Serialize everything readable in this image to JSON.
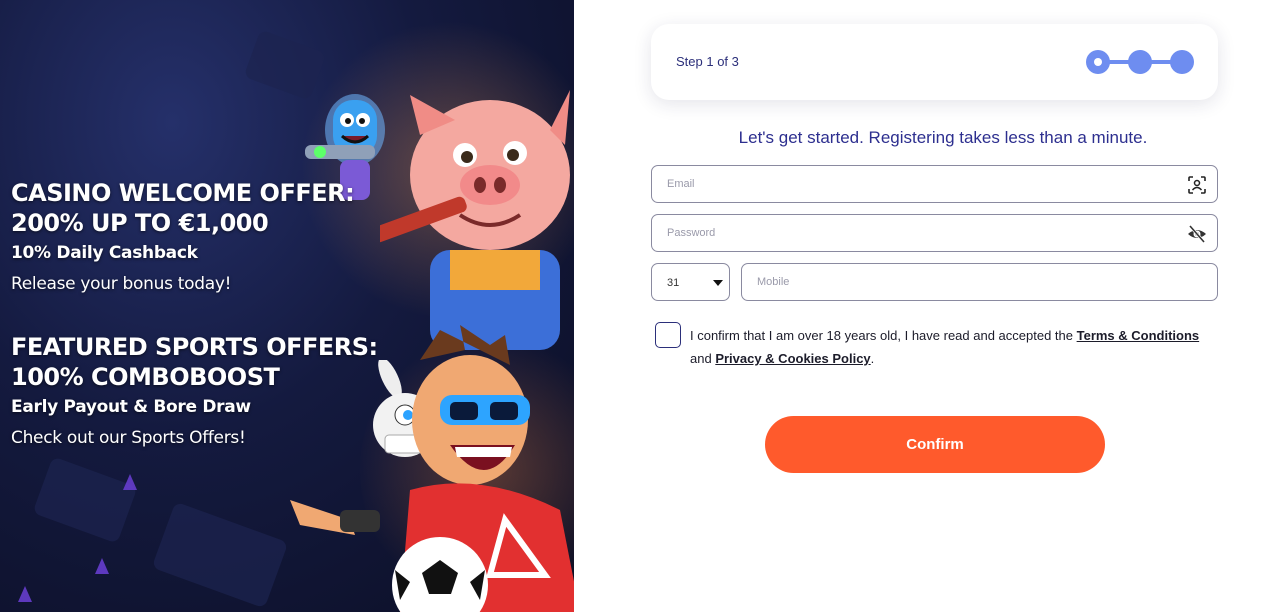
{
  "promo": {
    "casino_title_line1": "CASINO WELCOME OFFER:",
    "casino_title_line2": "200% UP TO €1,000",
    "casino_sub": "10% Daily Cashback",
    "casino_body": "Release your bonus today!",
    "sports_title_line1": "FEATURED SPORTS OFFERS:",
    "sports_title_line2": "100% COMBOBOOST",
    "sports_sub": "Early Payout & Bore Draw",
    "sports_body": "Check out our Sports Offers!"
  },
  "stepper": {
    "label": "Step 1 of 3",
    "current_step": 1,
    "total_steps": 3
  },
  "form": {
    "intro": "Let's get started. Registering takes less than a minute.",
    "email_placeholder": "Email",
    "password_placeholder": "Password",
    "country_code": "31",
    "mobile_placeholder": "Mobile",
    "consent_text_1": "I confirm that I am over 18 years old, I have read and accepted the ",
    "terms_link": "Terms & Conditions",
    "consent_and": "and ",
    "privacy_link": "Privacy & Cookies Policy",
    "consent_end": ".",
    "confirm_label": "Confirm"
  },
  "colors": {
    "accent": "#ff5a2c",
    "stepper": "#6e8df0",
    "heading": "#2d2f8f",
    "promo_bg": "#141a3f"
  },
  "icons": {
    "email_field_icon": "face-scan-icon",
    "password_field_icon": "eye-off-icon",
    "select_icon": "caret-down-icon"
  }
}
